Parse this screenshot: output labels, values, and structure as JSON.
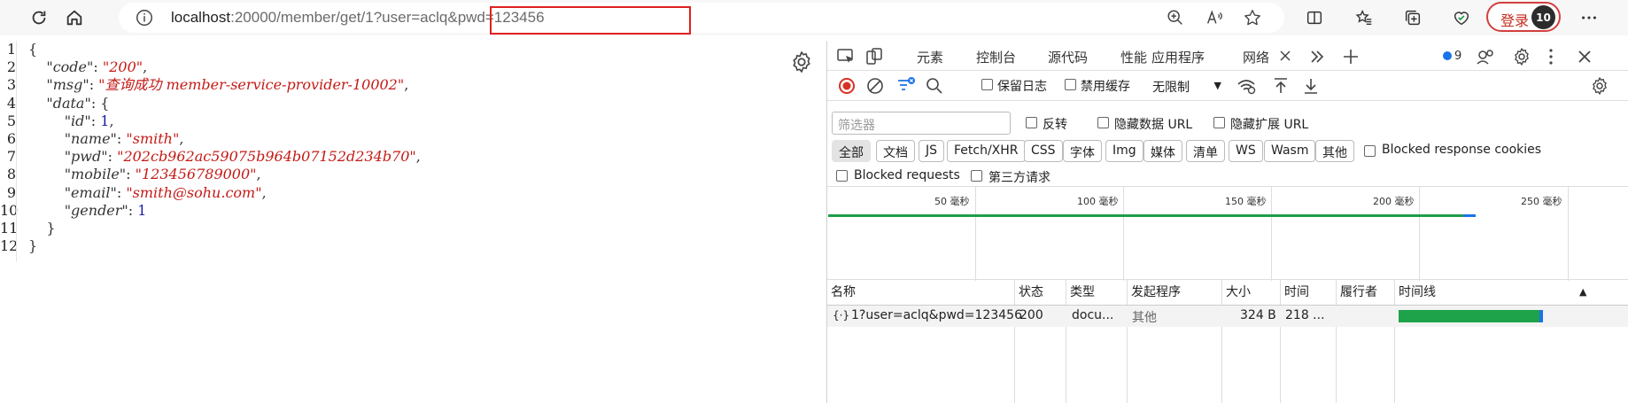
{
  "browser": {
    "url_host": "localhost",
    "url_path": ":20000/member/get/",
    "url_query": "1?user=aclq&pwd=123456",
    "login_label": "登录",
    "avatar_text": "10"
  },
  "json_viewer": {
    "line_numbers": [
      "1",
      "2",
      "3",
      "4",
      "5",
      "6",
      "7",
      "8",
      "9",
      "10",
      "11",
      "12"
    ],
    "code": {
      "code_key": "\"code\"",
      "code_val": "\"200\"",
      "msg_key": "\"msg\"",
      "msg_val": "\"查询成功 member-service-provider-10002\"",
      "data_key": "\"data\"",
      "id_key": "\"id\"",
      "id_val": "1",
      "name_key": "\"name\"",
      "name_val": "\"smith\"",
      "pwd_key": "\"pwd\"",
      "pwd_val": "\"202cb962ac59075b964b07152d234b70\"",
      "mobile_key": "\"mobile\"",
      "mobile_val": "\"123456789000\"",
      "email_key": "\"email\"",
      "email_val": "\"smith@sohu.com\"",
      "gender_key": "\"gender\"",
      "gender_val": "1"
    }
  },
  "devtools": {
    "tabs": [
      "元素",
      "控制台",
      "源代码",
      "性能",
      "应用程序",
      "网络"
    ],
    "issue_count": "9",
    "toolbar": {
      "preserve_log": "保留日志",
      "disable_cache": "禁用缓存",
      "throttle": "无限制"
    },
    "filter": {
      "placeholder": "筛选器",
      "invert": "反转",
      "hide_data_urls": "隐藏数据 URL",
      "hide_ext_urls": "隐藏扩展 URL"
    },
    "type_filters": [
      "全部",
      "文档",
      "JS",
      "Fetch/XHR",
      "CSS",
      "字体",
      "Img",
      "媒体",
      "清单",
      "WS",
      "Wasm",
      "其他"
    ],
    "blocked_cookies": "Blocked response cookies",
    "blocked_requests": "Blocked requests",
    "third_party": "第三方请求",
    "timeline_ticks": [
      "50 毫秒",
      "100 毫秒",
      "150 毫秒",
      "200 毫秒",
      "250 毫秒"
    ],
    "columns": [
      "名称",
      "状态",
      "类型",
      "发起程序",
      "大小",
      "时间",
      "履行者",
      "时间线"
    ],
    "rows": [
      {
        "name": "1?user=aclq&pwd=123456",
        "status": "200",
        "type": "docu...",
        "initiator": "其他",
        "size": "324 B",
        "time": "218 ...",
        "fulfilled": ""
      }
    ]
  }
}
